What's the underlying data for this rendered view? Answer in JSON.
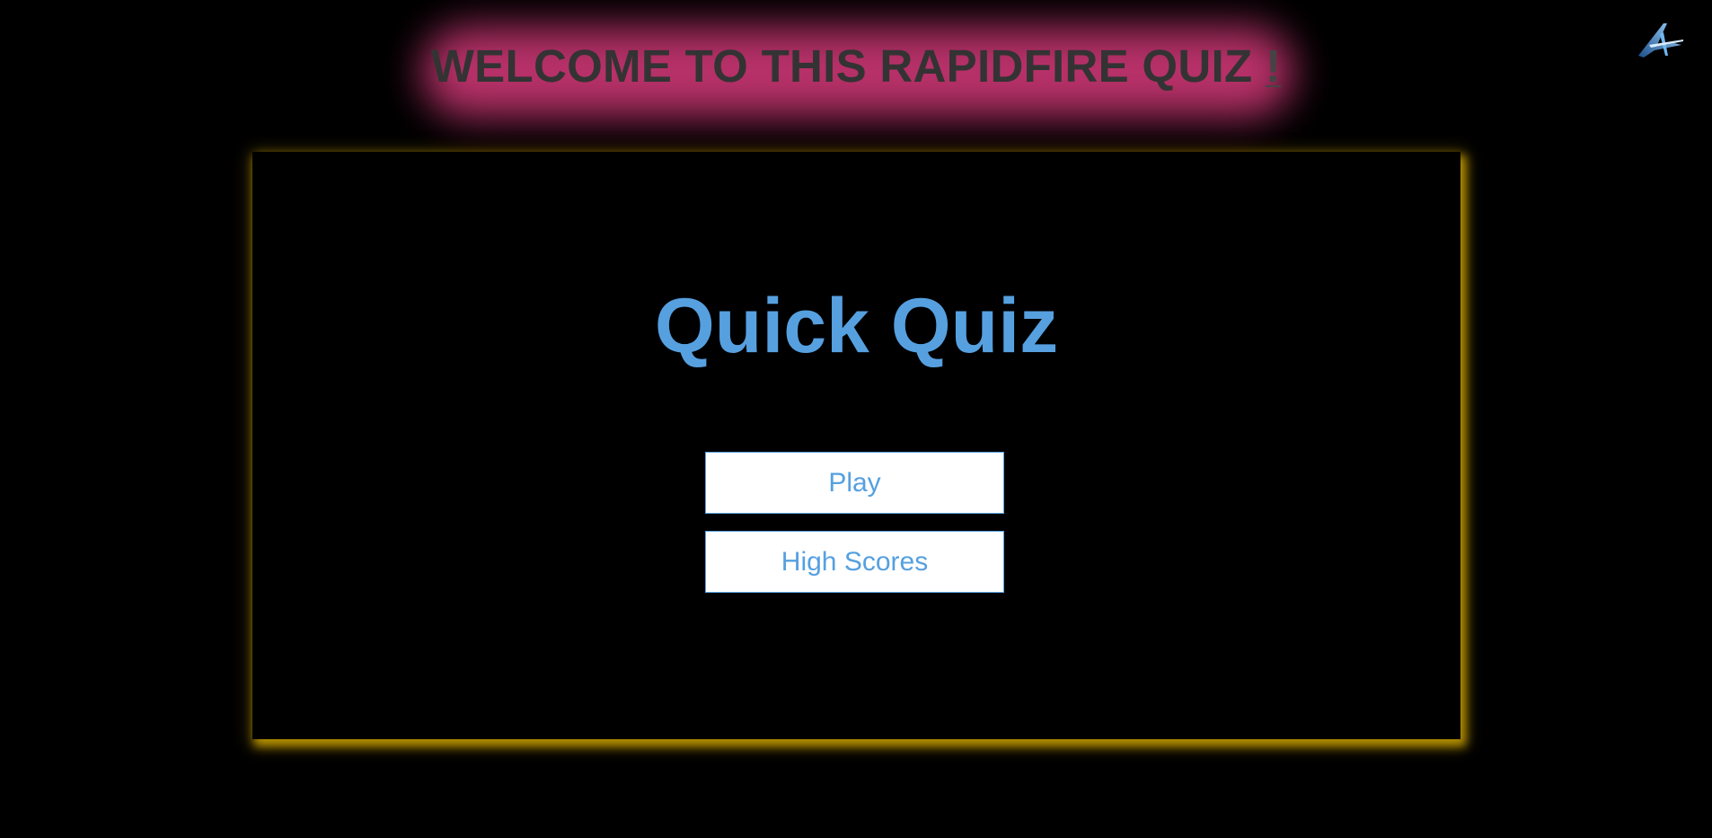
{
  "header": {
    "title": "WELCOME TO THIS RAPIDFIRE QUIZ",
    "title_suffix": "!",
    "glow_color": "#c2346f",
    "text_color": "#333333"
  },
  "logo": {
    "icon": "stylized-a-logo-icon"
  },
  "panel": {
    "title": "Quick Quiz",
    "title_color": "#56a0e0",
    "glow_color": "#c9a000",
    "buttons": {
      "play_label": "Play",
      "high_scores_label": "High Scores"
    }
  }
}
